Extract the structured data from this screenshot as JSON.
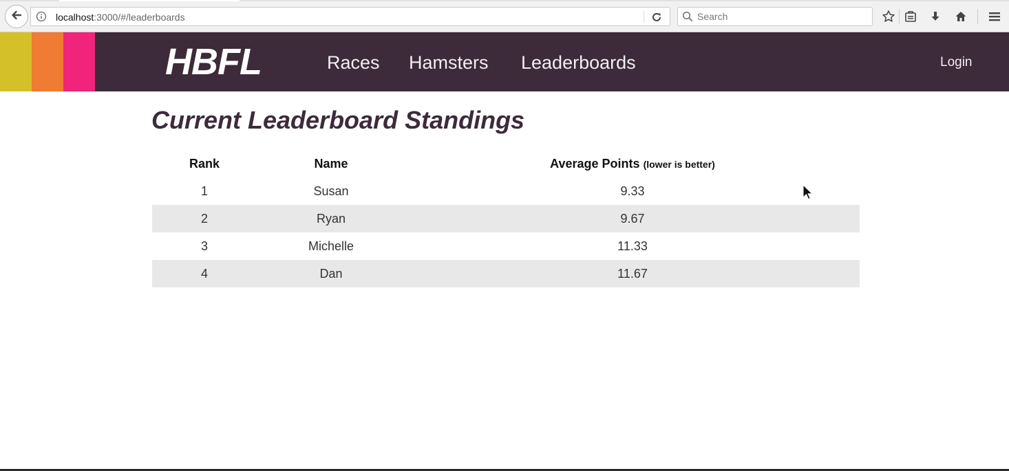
{
  "browser": {
    "url_host": "localhost",
    "url_rest": ":3000/#/leaderboards",
    "search_placeholder": "Search"
  },
  "header": {
    "stripe_colors": [
      "#d4c12a",
      "#f07b33",
      "#f0247b"
    ],
    "background": "#3d2a3a",
    "logo": "HBFL",
    "nav": [
      {
        "label": "Races"
      },
      {
        "label": "Hamsters"
      },
      {
        "label": "Leaderboards"
      }
    ],
    "login": "Login"
  },
  "main": {
    "title": "Current Leaderboard Standings",
    "columns": {
      "rank": "Rank",
      "name": "Name",
      "average": "Average Points",
      "average_note": "(lower is better)"
    },
    "rows": [
      {
        "rank": "1",
        "name": "Susan",
        "average": "9.33"
      },
      {
        "rank": "2",
        "name": "Ryan",
        "average": "9.67"
      },
      {
        "rank": "3",
        "name": "Michelle",
        "average": "11.33"
      },
      {
        "rank": "4",
        "name": "Dan",
        "average": "11.67"
      }
    ]
  }
}
